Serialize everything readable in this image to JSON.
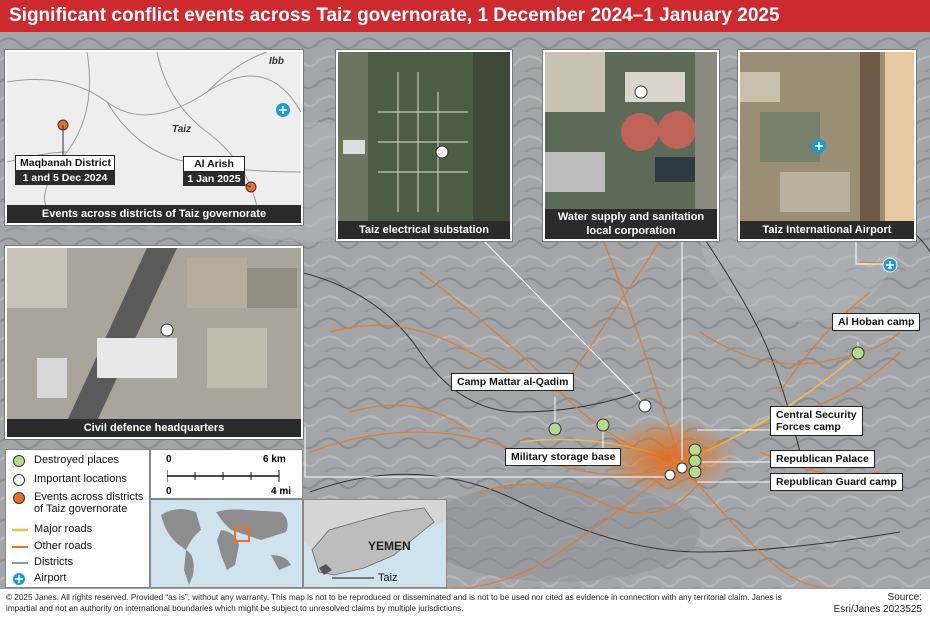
{
  "title": "Significant conflict events across Taiz governorate, 1 December 2024–1 January 2025",
  "colors": {
    "title_bg": "#cc2a2f",
    "destroyed": "#b5dc8e",
    "important": "#ffffff",
    "events": "#e8702a",
    "major_roads": "#e8c14a",
    "other_roads": "#e07a2a",
    "districts": "#333333",
    "airport": "#1f9ad6"
  },
  "insets": {
    "districts": {
      "caption": "Events across districts of Taiz governorate",
      "place_ibb": "Ibb",
      "place_taiz": "Taiz",
      "events": [
        {
          "name": "Maqbanah District",
          "date": "1 and 5 Dec 2024"
        },
        {
          "name": "Al Arish",
          "date": "1 Jan 2025"
        }
      ]
    },
    "substation": {
      "caption": "Taiz electrical substation"
    },
    "water": {
      "caption_line1": "Water supply and sanitation",
      "caption_line2": "local corporation"
    },
    "airport": {
      "caption": "Taiz International Airport"
    },
    "civil_defence": {
      "caption": "Civil defence headquarters"
    }
  },
  "map_labels": {
    "al_hoban": "Al Hoban camp",
    "camp_mattar": "Camp Mattar al-Qadim",
    "military_storage": "Military storage base",
    "central_security_l1": "Central Security",
    "central_security_l2": "Forces camp",
    "republican_palace": "Republican Palace",
    "republican_guard": "Republican Guard camp"
  },
  "legend": {
    "destroyed": "Destroyed places",
    "important": "Important locations",
    "events_l1": "Events across districts",
    "events_l2": "of Taiz governorate",
    "major_roads": "Major roads",
    "other_roads": "Other roads",
    "districts": "Districts",
    "airport": "Airport"
  },
  "scale": {
    "km_start": "0",
    "km_end": "6 km",
    "mi_start": "0",
    "mi_end": "4 mi"
  },
  "locator": {
    "country": "YEMEN",
    "city": "Taiz"
  },
  "footer": {
    "disclaimer": "© 2025 Janes. All rights reserved. Provided “as is”, without any warranty. This map is not to be reproduced or disseminated and is not to be used nor cited as evidence in connection with any territorial claim. Janes is impartial and not an authority on international boundaries which might be subject to unresolved claims by multiple jurisdictions.",
    "source_label": "Source:",
    "source_value": "Esri/Janes 2023525"
  }
}
